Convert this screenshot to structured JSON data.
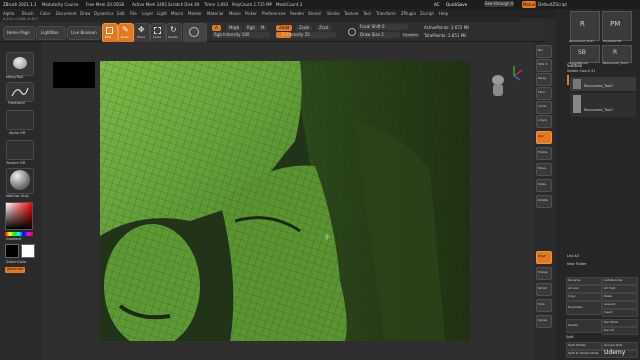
{
  "title_bar": {
    "app_title": "ZBrush 2021.1.1",
    "doc_info": "Modularity Course",
    "mem_free": "Free Mem 20.05GB",
    "mem_active": "Active Mem 2465",
    "scratch_disk": "Scratch Disk 49",
    "timer": "Timer 1.693",
    "polycount": "PolyCount 2.715 MP",
    "meshcount": "MeshCount 3",
    "ac_label": "AC",
    "quicksave_label": "QuickSave",
    "seethrough_label": "See-through 0",
    "menus_label": "Menus",
    "default_script": "DefaultZScript"
  },
  "menu_bar": {
    "items": [
      "Alpha",
      "Brush",
      "Color",
      "Document",
      "Draw",
      "Dynamics",
      "Edit",
      "File",
      "Layer",
      "Light",
      "Macro",
      "Marker",
      "Material",
      "Movie",
      "Picker",
      "Preferences",
      "Render",
      "Stencil",
      "Stroke",
      "Texture",
      "Tool",
      "Transform",
      "ZPlugin",
      "Zscript",
      "Help"
    ]
  },
  "status_line": {
    "coords": "0.215,-0.548,-0.427"
  },
  "shelf": {
    "home_page": "Home Page",
    "lightbox": "LightBox",
    "live_boolean": "Live Boolean",
    "edit": "Edit",
    "draw": "Draw",
    "move": "Move",
    "scale": "Scale",
    "rotate": "Rotate",
    "a_label": "A",
    "mrgb": "Mrgb",
    "rgb": "Rgb",
    "m": "M",
    "zadd": "Zadd",
    "zsub": "Zsub",
    "zcut": "Zcut",
    "rgb_intensity": "Rgb Intensity 100",
    "z_intensity": "Z Intensity 25",
    "focal_shift": "Focal Shift 0",
    "draw_size": "Draw Size 2",
    "dynamic": "Dynamic",
    "active_points": "ActivePoints: 2.672 Mil",
    "total_points": "TotalPoints: 3.851 Mil"
  },
  "left_shelf": {
    "brush": "Move/Tool",
    "stroke": "FreeHand",
    "alpha": "Alpha Off",
    "texture": "Texture Off",
    "material": "MatCap Gray",
    "gradient": "Gradient",
    "switch_color": "SwitchColor",
    "alternate": "Alternate"
  },
  "tray": {
    "tool_names": [
      "Recovered_Tool1",
      "PolyMesh3D",
      "SimpleBrush",
      "Recovered_Tool1"
    ],
    "tool_labels": [
      "R",
      "PM",
      "SB",
      "R"
    ],
    "subtool_header": "Subtool",
    "visible_count": "Visible Count 31",
    "subtool_items": [
      "Recovered_Tool1",
      "Recovered_Tool1"
    ],
    "list_all": "List All",
    "new_folder": "New Folder",
    "buttons": [
      [
        "Rename",
        "AutoReorder"
      ],
      [
        "All Low",
        "All High"
      ],
      [
        "Copy",
        "Paste"
      ],
      [
        "Duplicate",
        "Append"
      ],
      [
        "",
        "Insert"
      ],
      [
        "Delete",
        "Del Other"
      ],
      [
        "",
        "Del All"
      ]
    ],
    "split_header": "Split",
    "split_hidden": "Split Hidden",
    "groups_split": "Groups Split",
    "split_to_similar": "Split To Similar Parts"
  },
  "right_vert": {
    "labels": [
      "Bpr",
      "SPix 3",
      "Persp",
      "Floor",
      "Local",
      "L.Sym",
      "Xyz",
      "Frame",
      "Move",
      "Scale",
      "Rotate",
      "PolyF",
      "Transp",
      "Ghost",
      "Solo",
      "Xpose"
    ]
  },
  "watermark": "Udemy",
  "colors": {
    "accent": "#e2781f",
    "mesh_green": "#6fae3e",
    "panel": "#2b2b2b",
    "primary_color": "#ffffff",
    "secondary_color": "#000000"
  }
}
